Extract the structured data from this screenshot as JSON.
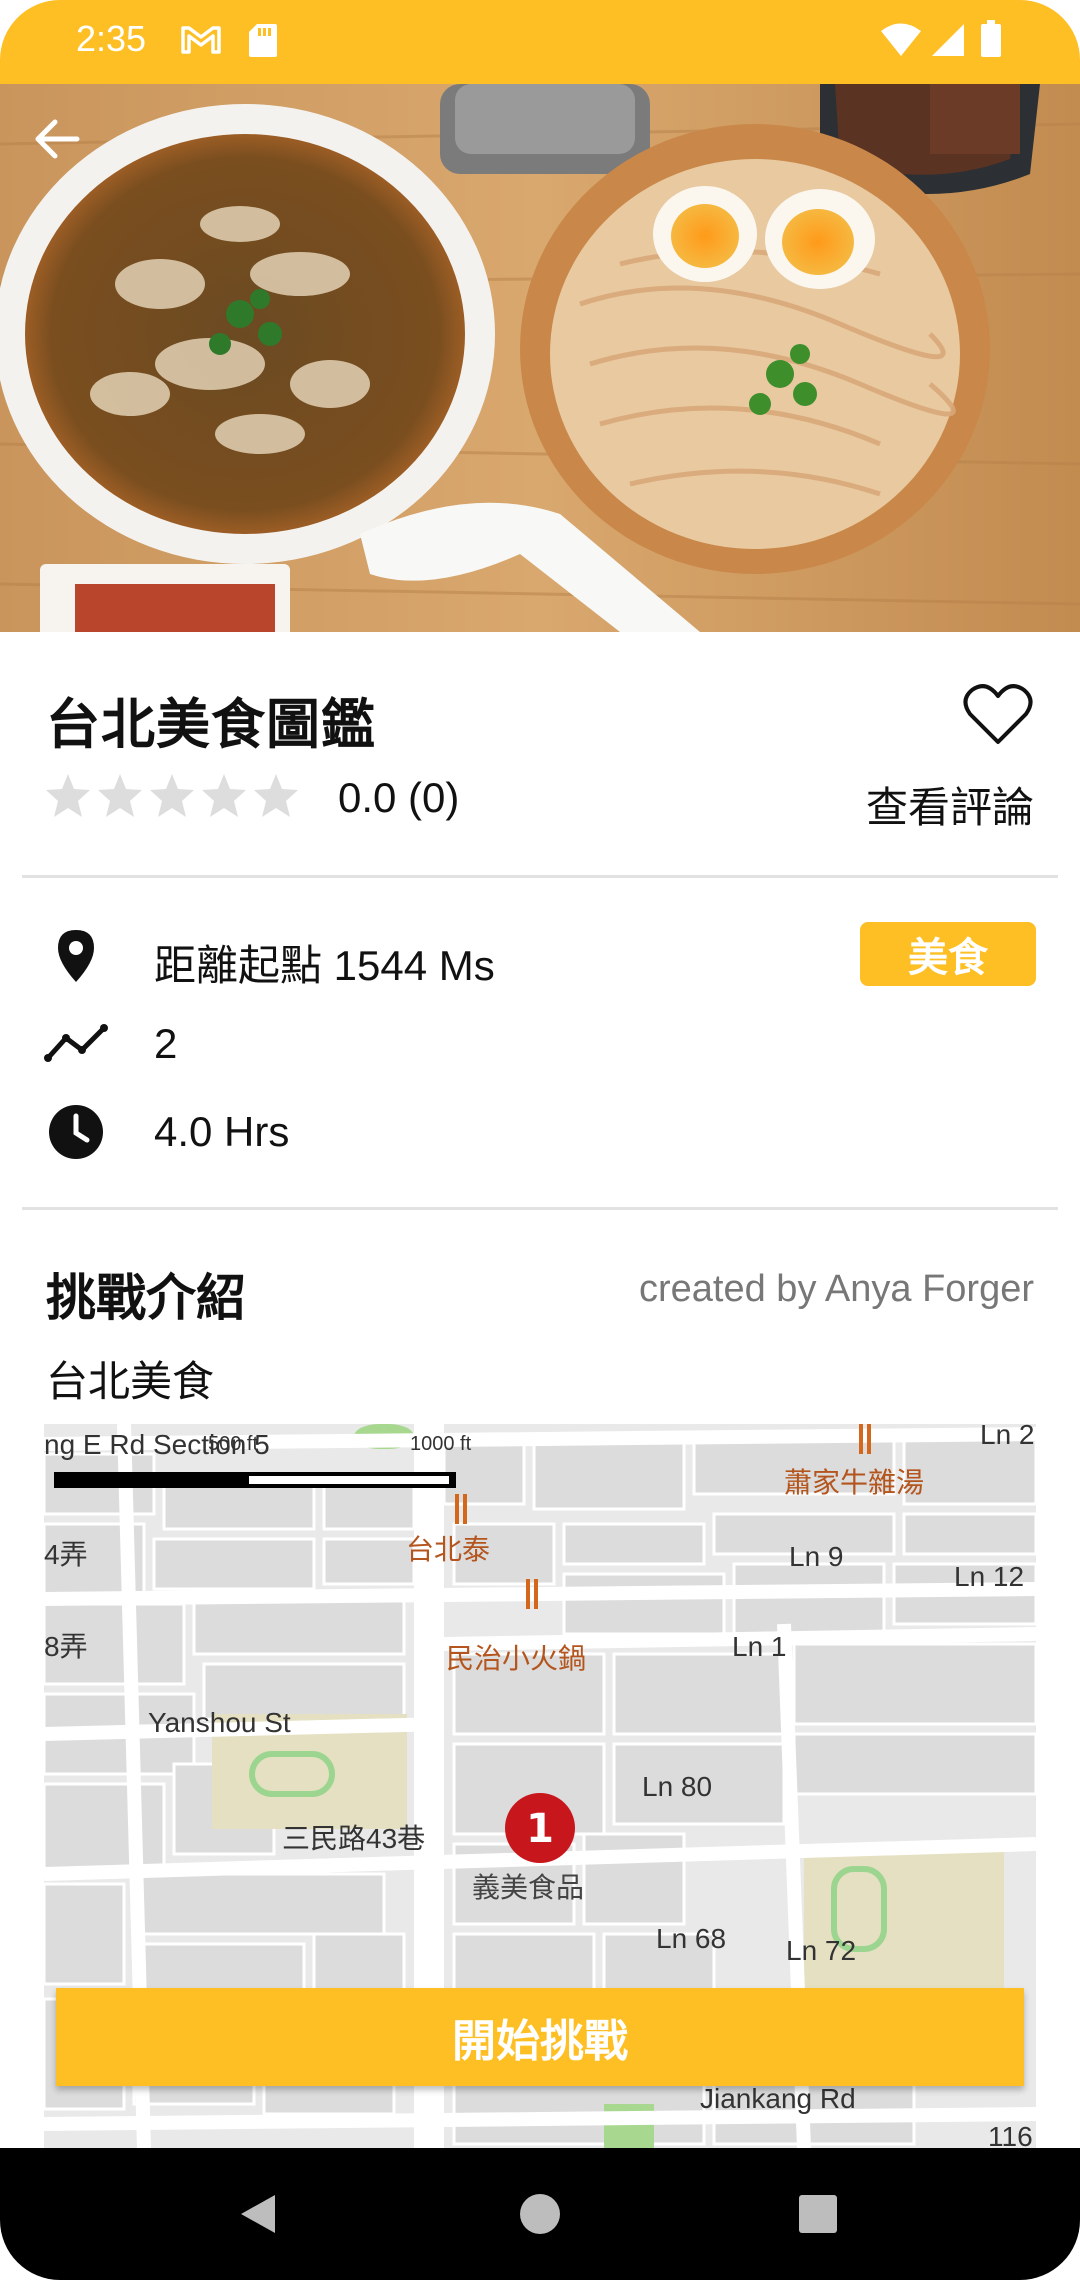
{
  "status_bar": {
    "time": "2:35",
    "icons": [
      "gmail-icon",
      "sd-card-icon",
      "wifi-icon",
      "signal-icon",
      "battery-icon"
    ]
  },
  "colors": {
    "accent": "#FDBF24",
    "text": "#111111",
    "muted": "#777777",
    "divider": "#E2E2E2",
    "star_empty": "#DDDDDD"
  },
  "header": {
    "back_icon": "arrow-left-icon"
  },
  "detail": {
    "title": "台北美食圖鑑",
    "favorite_icon": "heart-outline-icon",
    "rating_stars": 0,
    "rating_text": "0.0 (0)",
    "reviews_link": "查看評論"
  },
  "info": {
    "distance": "距離起點 1544 Ms",
    "category_tag": "美食",
    "route_points": "2",
    "duration": "4.0 Hrs"
  },
  "intro": {
    "section_title": "挑戰介紹",
    "creator": "created by Anya Forger",
    "description": "台北美食"
  },
  "map": {
    "scale_500": "500 ft",
    "scale_1000": "1000 ft",
    "roads": [
      "ng E Rd Section 5",
      "Ln 2",
      "蕭家牛雜湯",
      "4弄",
      "Ln 9",
      "Ln 12",
      "台北泰",
      "8弄",
      "Ln 1",
      "民治小火鍋",
      "Yanshou St",
      "Ln 80",
      "三民路43巷",
      "義美食品",
      "Ln 68",
      "Ln 72",
      "Jiankang Rd",
      "116"
    ],
    "marker_label": "1",
    "marker_place": "義美食品"
  },
  "actions": {
    "start_challenge": "開始挑戰"
  },
  "nav_bar": {
    "icons": [
      "nav-back-icon",
      "nav-home-icon",
      "nav-recents-icon"
    ]
  }
}
